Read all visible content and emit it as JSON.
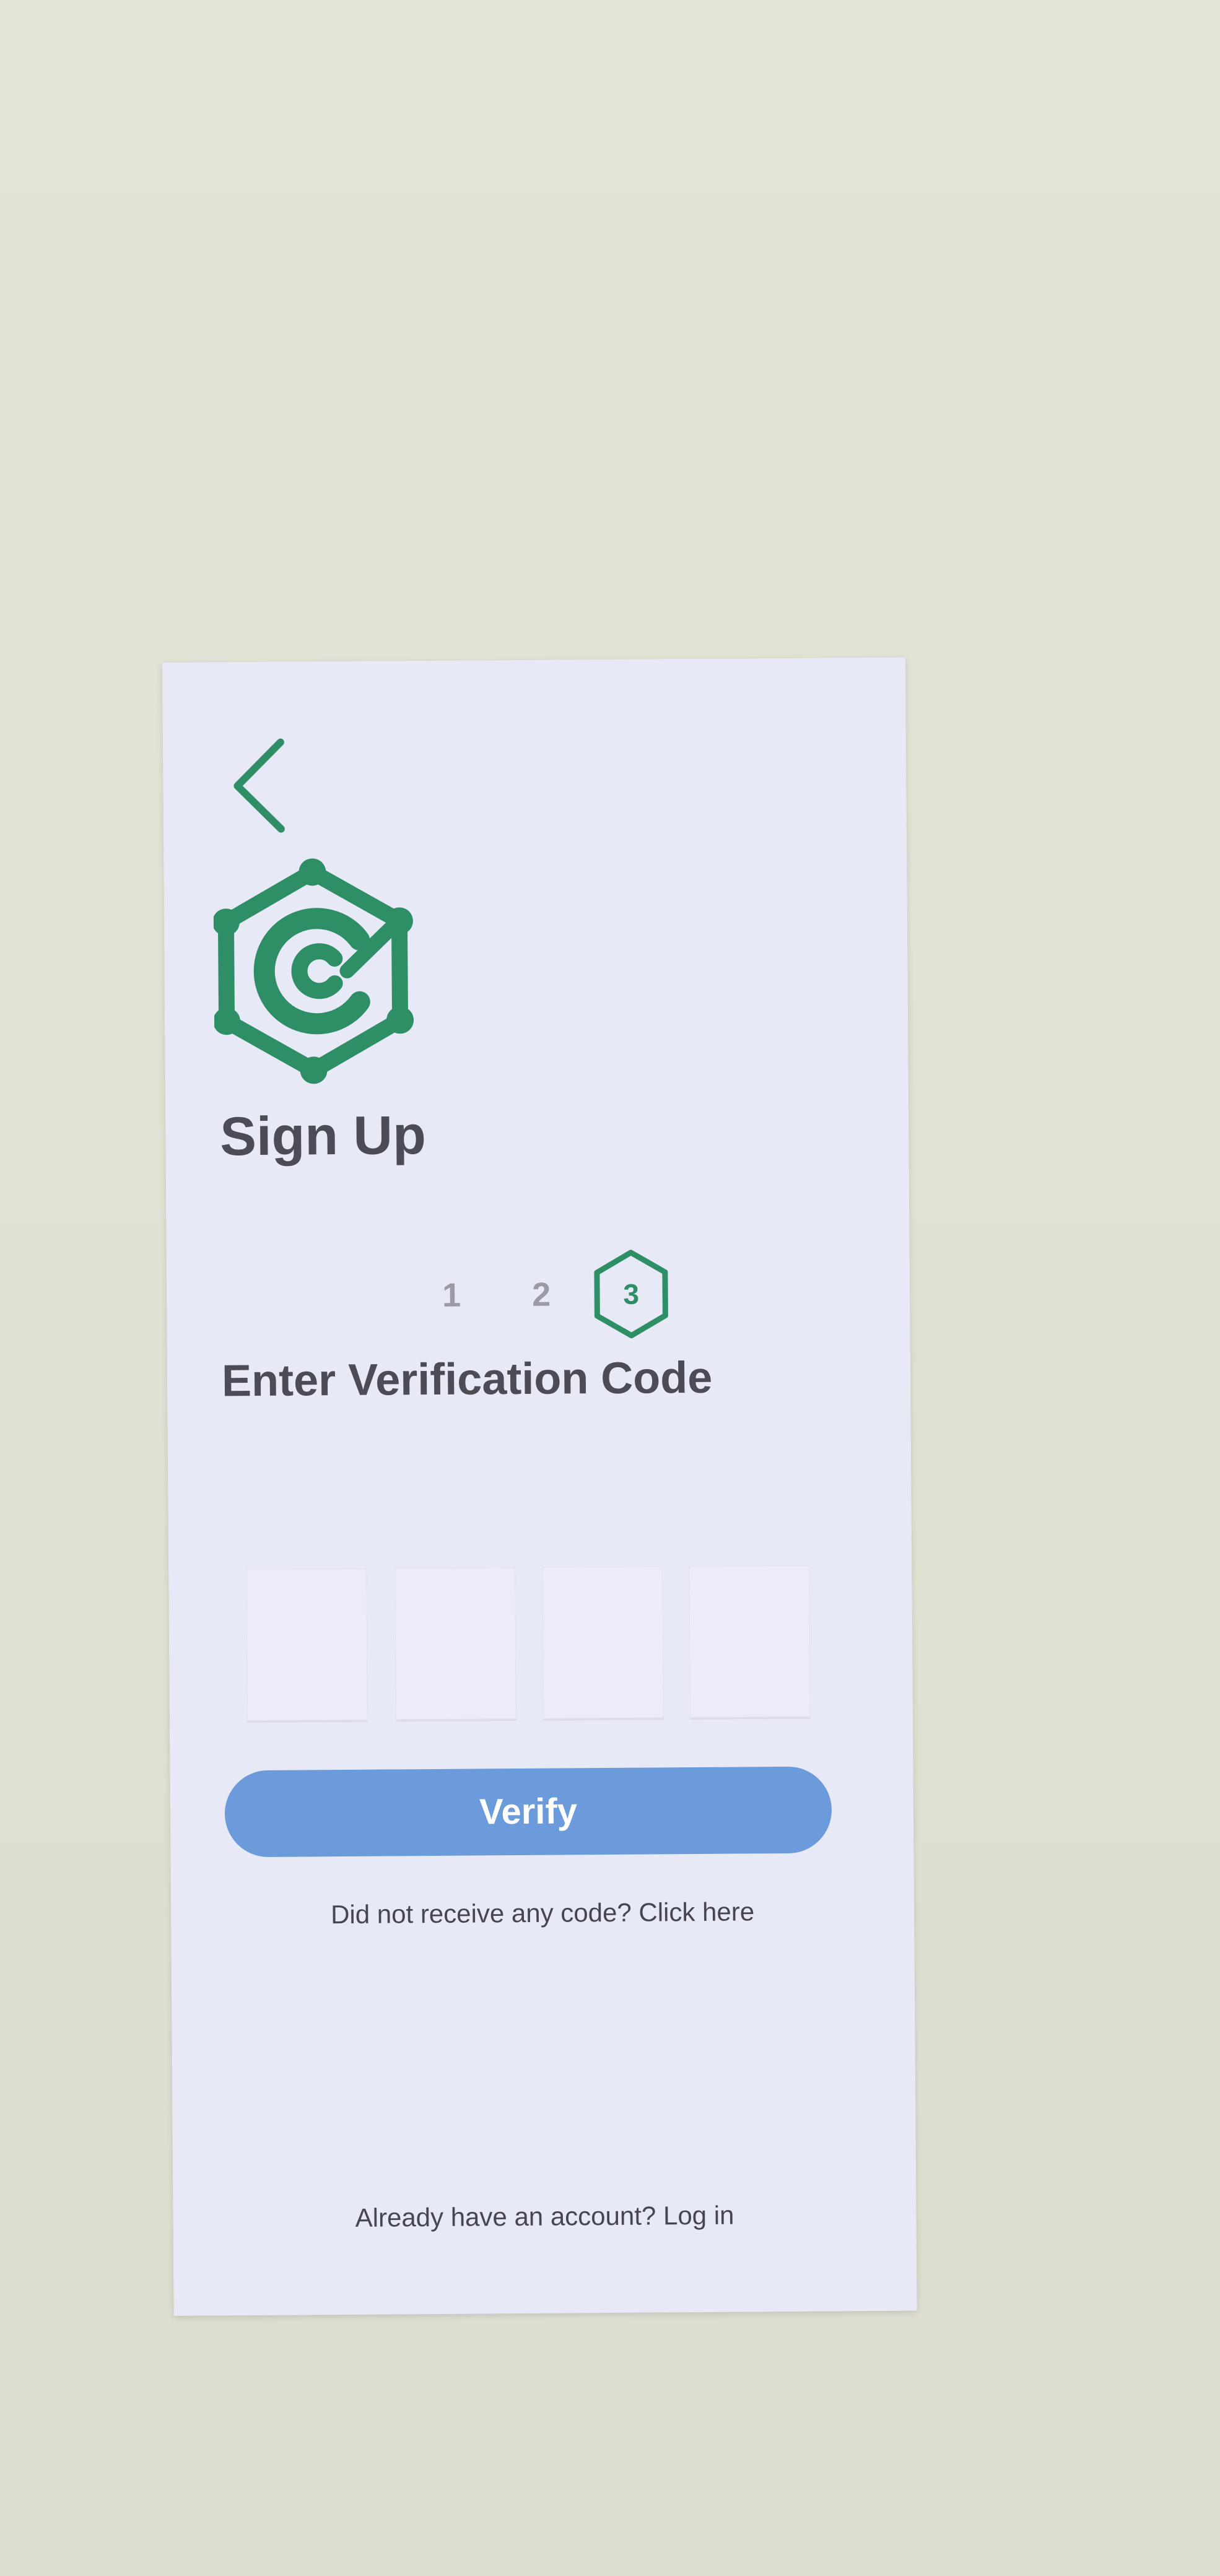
{
  "screen": {
    "title": "Sign Up",
    "subtitle": "Enter Verification Code"
  },
  "back": {
    "icon": "chevron-left-icon"
  },
  "logo": {
    "icon": "hexagon-c-logo-icon",
    "color": "#2e8f67"
  },
  "steps": {
    "items": [
      "1",
      "2",
      "3"
    ],
    "active": "3",
    "active_color": "#2e8f67"
  },
  "code_inputs": {
    "count": 4,
    "values": [
      "",
      "",
      "",
      ""
    ]
  },
  "verify": {
    "label": "Verify",
    "color": "#6b9bda"
  },
  "resend": {
    "text": "Did not receive any code?",
    "link": "Click here"
  },
  "login": {
    "text": "Already have an account?",
    "link": "Log in"
  }
}
